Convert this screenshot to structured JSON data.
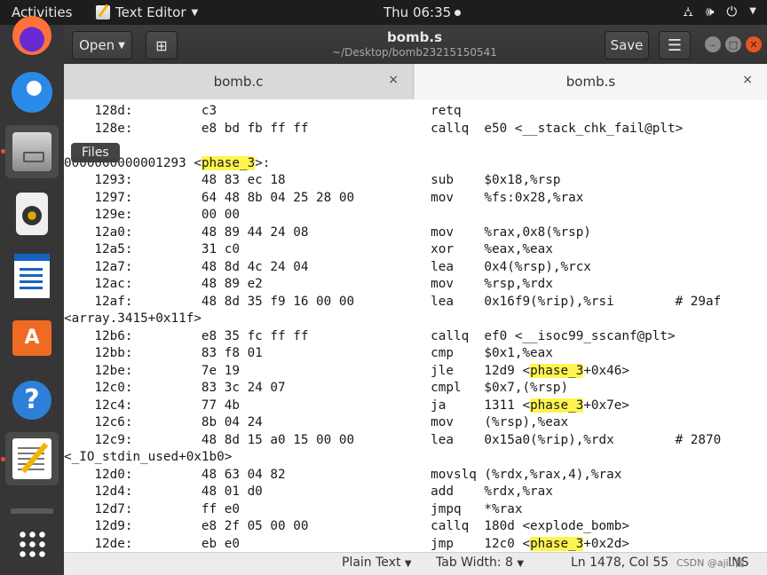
{
  "topbar": {
    "activities": "Activities",
    "app_name": "Text Editor",
    "clock": "Thu 06:35"
  },
  "dock": {
    "tooltip": "Files",
    "apps": [
      "firefox-icon",
      "thunderbird-icon",
      "files-icon",
      "rhythmbox-icon",
      "libreoffice-writer-icon",
      "software-center-icon",
      "help-icon",
      "text-editor-icon",
      "trash-icon",
      "app-grid-icon"
    ]
  },
  "window": {
    "open_label": "Open",
    "save_label": "Save",
    "title": "bomb.s",
    "subtitle": "~/Desktop/bomb23215150541"
  },
  "tabs": [
    {
      "label": "bomb.c",
      "close": "×"
    },
    {
      "label": "bomb.s",
      "close": "×"
    }
  ],
  "code_lines": [
    {
      "pre": "    128d:         c3                            retq",
      "hl": "",
      "post": ""
    },
    {
      "pre": "    128e:         e8 bd fb ff ff                callq  e50 <__stack_chk_fail@plt>",
      "hl": "",
      "post": ""
    },
    {
      "pre": "",
      "hl": "",
      "post": ""
    },
    {
      "pre": "0000000000001293 <",
      "hl": "phase_3",
      "post": ">:"
    },
    {
      "pre": "    1293:         48 83 ec 18                   sub    $0x18,%rsp",
      "hl": "",
      "post": ""
    },
    {
      "pre": "    1297:         64 48 8b 04 25 28 00          mov    %fs:0x28,%rax",
      "hl": "",
      "post": ""
    },
    {
      "pre": "    129e:         00 00",
      "hl": "",
      "post": ""
    },
    {
      "pre": "    12a0:         48 89 44 24 08                mov    %rax,0x8(%rsp)",
      "hl": "",
      "post": ""
    },
    {
      "pre": "    12a5:         31 c0                         xor    %eax,%eax",
      "hl": "",
      "post": ""
    },
    {
      "pre": "    12a7:         48 8d 4c 24 04                lea    0x4(%rsp),%rcx",
      "hl": "",
      "post": ""
    },
    {
      "pre": "    12ac:         48 89 e2                      mov    %rsp,%rdx",
      "hl": "",
      "post": ""
    },
    {
      "pre": "    12af:         48 8d 35 f9 16 00 00          lea    0x16f9(%rip),%rsi        # 29af",
      "hl": "",
      "post": ""
    },
    {
      "pre": "<array.3415+0x11f>",
      "hl": "",
      "post": ""
    },
    {
      "pre": "    12b6:         e8 35 fc ff ff                callq  ef0 <__isoc99_sscanf@plt>",
      "hl": "",
      "post": ""
    },
    {
      "pre": "    12bb:         83 f8 01                      cmp    $0x1,%eax",
      "hl": "",
      "post": ""
    },
    {
      "pre": "    12be:         7e 19                         jle    12d9 <",
      "hl": "phase_3",
      "post": "+0x46>"
    },
    {
      "pre": "    12c0:         83 3c 24 07                   cmpl   $0x7,(%rsp)",
      "hl": "",
      "post": ""
    },
    {
      "pre": "    12c4:         77 4b                         ja     1311 <",
      "hl": "phase_3",
      "post": "+0x7e>"
    },
    {
      "pre": "    12c6:         8b 04 24                      mov    (%rsp),%eax",
      "hl": "",
      "post": ""
    },
    {
      "pre": "    12c9:         48 8d 15 a0 15 00 00          lea    0x15a0(%rip),%rdx        # 2870",
      "hl": "",
      "post": ""
    },
    {
      "pre": "<_IO_stdin_used+0x1b0>",
      "hl": "",
      "post": ""
    },
    {
      "pre": "    12d0:         48 63 04 82                   movslq (%rdx,%rax,4),%rax",
      "hl": "",
      "post": ""
    },
    {
      "pre": "    12d4:         48 01 d0                      add    %rdx,%rax",
      "hl": "",
      "post": ""
    },
    {
      "pre": "    12d7:         ff e0                         jmpq   *%rax",
      "hl": "",
      "post": ""
    },
    {
      "pre": "    12d9:         e8 2f 05 00 00                callq  180d <explode_bomb>",
      "hl": "",
      "post": ""
    },
    {
      "pre": "    12de:         eb e0                         jmp    12c0 <",
      "hl": "phase_3",
      "post": "+0x2d>"
    }
  ],
  "statusbar": {
    "syntax": "Plain Text",
    "tab_width": "Tab Width: 8",
    "position": "Ln 1478, Col 55",
    "mode": "INS"
  },
  "watermark": "CSDN @ajiu酱",
  "colors": {
    "accent": "#e95420",
    "highlight": "#fff44f",
    "dock": "#363636",
    "header": "#3a3a3a"
  }
}
